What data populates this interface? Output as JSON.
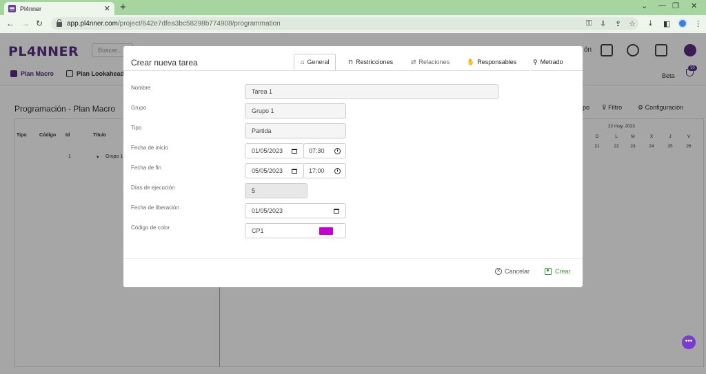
{
  "browser": {
    "tab_title": "Pl4nner",
    "url_host": "app.pl4nner.com",
    "url_path": "/project/642e7dfea3bc58298b774908/programmation"
  },
  "app": {
    "logo": "PL4NNER",
    "search_placeholder": "Buscar...",
    "nav": {
      "plan_macro": "Plan Macro",
      "plan_lookahead": "Plan Lookahead"
    },
    "header_partial": "ón",
    "beta": "Beta",
    "notif_count": "10",
    "page_title": "Programación - Plan Macro",
    "toolbar": {
      "partial": "po",
      "filter": "Filtro",
      "config": "Configuración"
    },
    "grid": {
      "columns": [
        "Tipo",
        "Código",
        "Id",
        "Título"
      ],
      "row": {
        "id": "1",
        "title": "Grupo 1"
      },
      "week_label": "22 may. 2023",
      "day_letters": [
        "D",
        "L",
        "M",
        "X",
        "J",
        "V"
      ],
      "day_numbers": [
        "21",
        "22",
        "23",
        "24",
        "25",
        "26"
      ]
    }
  },
  "modal": {
    "title": "Crear nueva tarea",
    "tabs": {
      "general": "General",
      "restricciones": "Restricciones",
      "relaciones": "Relaciones",
      "responsables": "Responsables",
      "metrado": "Metrado"
    },
    "fields": {
      "nombre": {
        "label": "Nombre",
        "value": "Tarea 1"
      },
      "grupo": {
        "label": "Grupo",
        "value": "Grupo 1"
      },
      "tipo": {
        "label": "Tipo",
        "value": "Partida"
      },
      "fecha_inicio": {
        "label": "Fecha de inicio",
        "date": "01/05/2023",
        "time": "07:30"
      },
      "fecha_fin": {
        "label": "Fecha de fin",
        "date": "05/05/2023",
        "time": "17:00"
      },
      "dias": {
        "label": "Días de ejecución",
        "value": "5"
      },
      "fecha_liberacion": {
        "label": "Fecha de liberación",
        "date": "01/05/2023"
      },
      "codigo_color": {
        "label": "Código de color",
        "value": "CP1",
        "color": "#c400d4"
      }
    },
    "buttons": {
      "cancel": "Cancelar",
      "create": "Crear"
    }
  },
  "colors": {
    "brand": "#5a2d82",
    "accent_green": "#3a9a3a",
    "browser_green": "#a7d5a0"
  }
}
